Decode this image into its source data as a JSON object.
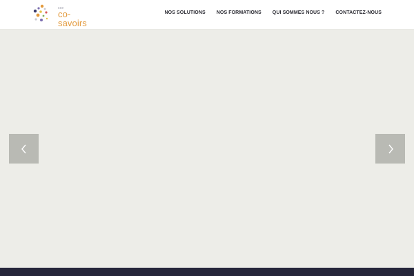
{
  "header": {
    "logo": {
      "small_text": "sce",
      "brand_text": "co-savoirs"
    },
    "nav": [
      {
        "label": "NOS SOLUTIONS"
      },
      {
        "label": "NOS FORMATIONS"
      },
      {
        "label": "QUI SOMMES NOUS ?"
      },
      {
        "label": "CONTACTEZ-NOUS"
      }
    ]
  },
  "slider": {
    "prev_icon": "chevron-left-icon",
    "next_icon": "chevron-right-icon"
  },
  "colors": {
    "brand_orange": "#e39a3c",
    "nav_text": "#2b2b33",
    "slider_bg": "#edede8",
    "arrow_bg": "#b9bab4",
    "footer_bg": "#26263a"
  }
}
